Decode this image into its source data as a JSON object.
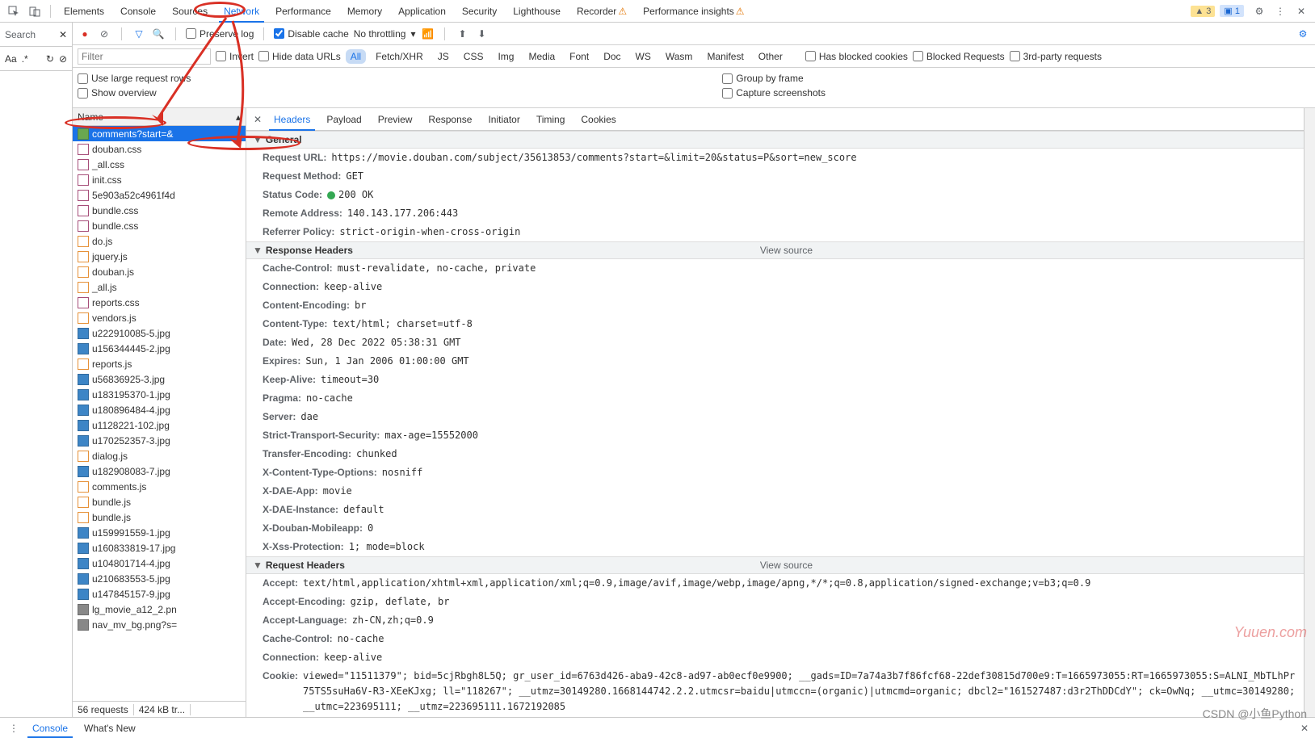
{
  "tabs": {
    "elements": "Elements",
    "console": "Console",
    "sources": "Sources",
    "network": "Network",
    "performance": "Performance",
    "memory": "Memory",
    "application": "Application",
    "security": "Security",
    "lighthouse": "Lighthouse",
    "recorder": "Recorder",
    "perf_insights": "Performance insights"
  },
  "badges": {
    "warn": "▲ 3",
    "info": "▣ 1"
  },
  "left": {
    "search": "Search",
    "aa": "Aa",
    "dot": ".*"
  },
  "toolbar": {
    "preserve": "Preserve log",
    "disable": "Disable cache",
    "throttle": "No throttling"
  },
  "filter": {
    "placeholder": "Filter",
    "invert": "Invert",
    "hide": "Hide data URLs",
    "cats": {
      "all": "All",
      "fetch": "Fetch/XHR",
      "js": "JS",
      "css": "CSS",
      "img": "Img",
      "media": "Media",
      "font": "Font",
      "doc": "Doc",
      "ws": "WS",
      "wasm": "Wasm",
      "manifest": "Manifest",
      "other": "Other"
    },
    "blocked_cookies": "Has blocked cookies",
    "blocked_req": "Blocked Requests",
    "third": "3rd-party requests"
  },
  "opts": {
    "large": "Use large request rows",
    "overview": "Show overview",
    "group": "Group by frame",
    "screenshots": "Capture screenshots"
  },
  "reqlist": {
    "header": "Name",
    "items": [
      {
        "n": "comments?start=&",
        "t": "doc"
      },
      {
        "n": "douban.css",
        "t": "css"
      },
      {
        "n": "_all.css",
        "t": "css"
      },
      {
        "n": "init.css",
        "t": "css"
      },
      {
        "n": "5e903a52c4961f4d",
        "t": "css"
      },
      {
        "n": "bundle.css",
        "t": "css"
      },
      {
        "n": "bundle.css",
        "t": "css"
      },
      {
        "n": "do.js",
        "t": "js"
      },
      {
        "n": "jquery.js",
        "t": "js"
      },
      {
        "n": "douban.js",
        "t": "js"
      },
      {
        "n": "_all.js",
        "t": "js"
      },
      {
        "n": "reports.css",
        "t": "css"
      },
      {
        "n": "vendors.js",
        "t": "js"
      },
      {
        "n": "u222910085-5.jpg",
        "t": "img"
      },
      {
        "n": "u156344445-2.jpg",
        "t": "img"
      },
      {
        "n": "reports.js",
        "t": "js"
      },
      {
        "n": "u56836925-3.jpg",
        "t": "img"
      },
      {
        "n": "u183195370-1.jpg",
        "t": "img"
      },
      {
        "n": "u180896484-4.jpg",
        "t": "img"
      },
      {
        "n": "u1128221-102.jpg",
        "t": "img"
      },
      {
        "n": "u170252357-3.jpg",
        "t": "img"
      },
      {
        "n": "dialog.js",
        "t": "js"
      },
      {
        "n": "u182908083-7.jpg",
        "t": "img"
      },
      {
        "n": "comments.js",
        "t": "js"
      },
      {
        "n": "bundle.js",
        "t": "js"
      },
      {
        "n": "bundle.js",
        "t": "js"
      },
      {
        "n": "u159991559-1.jpg",
        "t": "img"
      },
      {
        "n": "u160833819-17.jpg",
        "t": "img"
      },
      {
        "n": "u104801714-4.jpg",
        "t": "img"
      },
      {
        "n": "u210683553-5.jpg",
        "t": "img"
      },
      {
        "n": "u147845157-9.jpg",
        "t": "img"
      },
      {
        "n": "lg_movie_a12_2.pn",
        "t": "misc"
      },
      {
        "n": "nav_mv_bg.png?s=",
        "t": "misc"
      }
    ],
    "foot_left": "56 requests",
    "foot_right": "424 kB tr..."
  },
  "dtabs": {
    "headers": "Headers",
    "payload": "Payload",
    "preview": "Preview",
    "response": "Response",
    "initiator": "Initiator",
    "timing": "Timing",
    "cookies": "Cookies"
  },
  "sections": {
    "general": "General",
    "response_headers": "Response Headers",
    "request_headers": "Request Headers",
    "view_source": "View source"
  },
  "general": {
    "url_k": "Request URL:",
    "url_v": "https://movie.douban.com/subject/35613853/comments?start=&limit=20&status=P&sort=new_score",
    "method_k": "Request Method:",
    "method_v": "GET",
    "status_k": "Status Code:",
    "status_v": "200 OK",
    "remote_k": "Remote Address:",
    "remote_v": "140.143.177.206:443",
    "ref_k": "Referrer Policy:",
    "ref_v": "strict-origin-when-cross-origin"
  },
  "resp": [
    {
      "k": "Cache-Control:",
      "v": "must-revalidate, no-cache, private"
    },
    {
      "k": "Connection:",
      "v": "keep-alive"
    },
    {
      "k": "Content-Encoding:",
      "v": "br"
    },
    {
      "k": "Content-Type:",
      "v": "text/html; charset=utf-8"
    },
    {
      "k": "Date:",
      "v": "Wed, 28 Dec 2022 05:38:31 GMT"
    },
    {
      "k": "Expires:",
      "v": "Sun, 1 Jan 2006 01:00:00 GMT"
    },
    {
      "k": "Keep-Alive:",
      "v": "timeout=30"
    },
    {
      "k": "Pragma:",
      "v": "no-cache"
    },
    {
      "k": "Server:",
      "v": "dae"
    },
    {
      "k": "Strict-Transport-Security:",
      "v": "max-age=15552000"
    },
    {
      "k": "Transfer-Encoding:",
      "v": "chunked"
    },
    {
      "k": "X-Content-Type-Options:",
      "v": "nosniff"
    },
    {
      "k": "X-DAE-App:",
      "v": "movie"
    },
    {
      "k": "X-DAE-Instance:",
      "v": "default"
    },
    {
      "k": "X-Douban-Mobileapp:",
      "v": "0"
    },
    {
      "k": "X-Xss-Protection:",
      "v": "1; mode=block"
    }
  ],
  "req": [
    {
      "k": "Accept:",
      "v": "text/html,application/xhtml+xml,application/xml;q=0.9,image/avif,image/webp,image/apng,*/*;q=0.8,application/signed-exchange;v=b3;q=0.9"
    },
    {
      "k": "Accept-Encoding:",
      "v": "gzip, deflate, br"
    },
    {
      "k": "Accept-Language:",
      "v": "zh-CN,zh;q=0.9"
    },
    {
      "k": "Cache-Control:",
      "v": "no-cache"
    },
    {
      "k": "Connection:",
      "v": "keep-alive"
    },
    {
      "k": "Cookie:",
      "v": "viewed=\"11511379\"; bid=5cjRbgh8L5Q; gr_user_id=6763d426-aba9-42c8-ad97-ab0ecf0e9900; __gads=ID=7a74a3b7f86fcf68-22def30815d700e9:T=1665973055:RT=1665973055:S=ALNI_MbTLhPr75TS5suHa6V-R3-XEeKJxg; ll=\"118267\"; __utmz=30149280.1668144742.2.2.utmcsr=baidu|utmccn=(organic)|utmcmd=organic; dbcl2=\"161527487:d3r2ThDDCdY\"; ck=OwNq; __utmc=30149280; __utmc=223695111; __utmz=223695111.1672192085"
    }
  ],
  "bottom": {
    "console": "Console",
    "whats": "What's New"
  },
  "watermark1": "Yuuen.com",
  "watermark2": "CSDN @小鱼Python"
}
